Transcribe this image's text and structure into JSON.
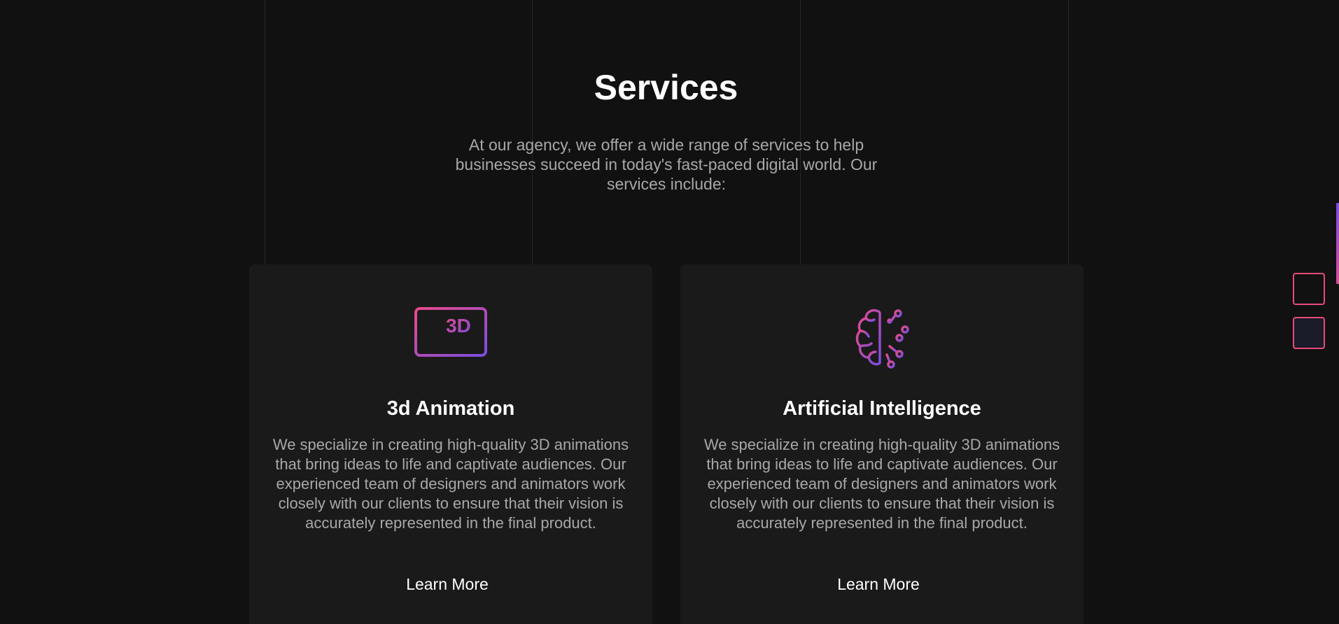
{
  "section": {
    "title": "Services",
    "intro": "At our agency, we offer a wide range of services to help businesses succeed in today's fast-paced digital world. Our services include:"
  },
  "cards": [
    {
      "icon": "monitor-3d-icon",
      "title": "3d Animation",
      "description": "We specialize in creating high-quality 3D animations that bring ideas to life and captivate audiences. Our experienced team of designers and animators work closely with our clients to ensure that their vision is accurately represented in the final product.",
      "link_label": "Learn More"
    },
    {
      "icon": "ai-brain-icon",
      "title": "Artificial Intelligence",
      "description": "We specialize in creating high-quality 3D animations that bring ideas to life and captivate audiences. Our experienced team of designers and animators work closely with our clients to ensure that their vision is accurately represented in the final product.",
      "link_label": "Learn More"
    }
  ],
  "monitor_label": "3D",
  "colors": {
    "background": "#111111",
    "card": "#1a1a1a",
    "accent_pink": "#e84a7a",
    "accent_purple": "#7b4de0",
    "text_muted": "#a8a8a8"
  }
}
